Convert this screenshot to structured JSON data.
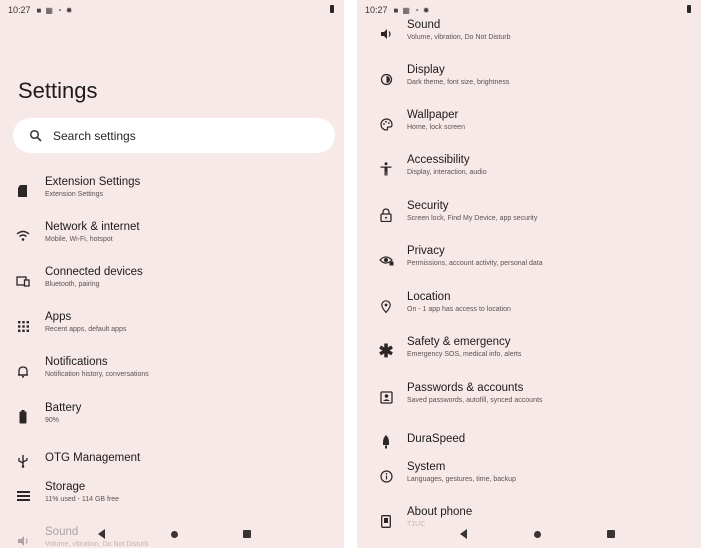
{
  "left": {
    "status": {
      "time": "10:27"
    },
    "page_title": "Settings",
    "search": {
      "placeholder": "Search settings"
    },
    "items": [
      {
        "icon": "sd-card-icon",
        "title": "Extension Settings",
        "subtitle": "Extension Settings"
      },
      {
        "icon": "wifi-icon",
        "title": "Network & internet",
        "subtitle": "Mobile, Wi-Fi, hotspot"
      },
      {
        "icon": "devices-icon",
        "title": "Connected devices",
        "subtitle": "Bluetooth, pairing"
      },
      {
        "icon": "apps-grid-icon",
        "title": "Apps",
        "subtitle": "Recent apps, default apps"
      },
      {
        "icon": "bell-icon",
        "title": "Notifications",
        "subtitle": "Notification history, conversations"
      },
      {
        "icon": "battery-icon",
        "title": "Battery",
        "subtitle": "90%"
      },
      {
        "icon": "usb-icon",
        "title": "OTG Management",
        "subtitle": ""
      },
      {
        "icon": "storage-icon",
        "title": "Storage",
        "subtitle": "11% used - 114 GB free"
      },
      {
        "icon": "volume-icon",
        "title": "Sound",
        "subtitle": "Volume, vibration, Do Not Disturb"
      }
    ]
  },
  "right": {
    "status": {
      "time": "10:27"
    },
    "items": [
      {
        "icon": "volume-icon",
        "title": "Sound",
        "subtitle": "Volume, vibration, Do Not Disturb"
      },
      {
        "icon": "display-icon",
        "title": "Display",
        "subtitle": "Dark theme, font size, brightness"
      },
      {
        "icon": "palette-icon",
        "title": "Wallpaper",
        "subtitle": "Home, lock screen"
      },
      {
        "icon": "accessibility-icon",
        "title": "Accessibility",
        "subtitle": "Display, interaction, audio"
      },
      {
        "icon": "lock-icon",
        "title": "Security",
        "subtitle": "Screen lock, Find My Device, app security"
      },
      {
        "icon": "privacy-eye-icon",
        "title": "Privacy",
        "subtitle": "Permissions, account activity, personal data"
      },
      {
        "icon": "location-pin-icon",
        "title": "Location",
        "subtitle": "On - 1 app has access to location"
      },
      {
        "icon": "asterisk-icon",
        "title": "Safety & emergency",
        "subtitle": "Emergency SOS, medical info, alerts"
      },
      {
        "icon": "account-box-icon",
        "title": "Passwords & accounts",
        "subtitle": "Saved passwords, autofill, synced accounts"
      },
      {
        "icon": "rocket-icon",
        "title": "DuraSpeed",
        "subtitle": ""
      },
      {
        "icon": "info-icon",
        "title": "System",
        "subtitle": "Languages, gestures, time, backup"
      },
      {
        "icon": "phone-icon",
        "title": "About phone",
        "subtitle": "T1UC"
      }
    ]
  }
}
